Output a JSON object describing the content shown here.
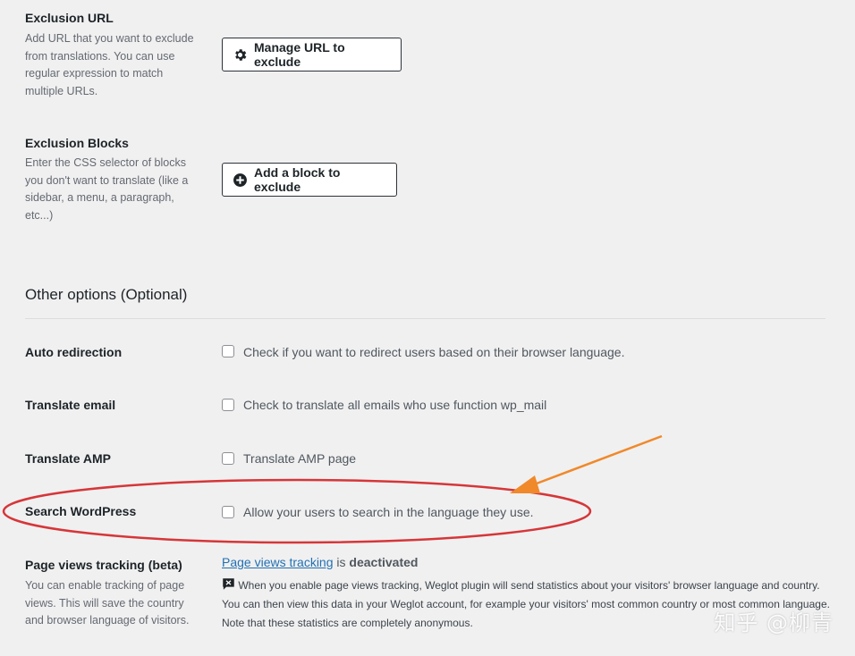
{
  "exclusion_url": {
    "label": "Exclusion URL",
    "description": [
      "Add URL that you want to exclude",
      "from translations. You can use",
      "regular expression to match",
      "multiple URLs."
    ],
    "button_label": "Manage URL to exclude",
    "button_icon": "gear-icon"
  },
  "exclusion_blocks": {
    "label": "Exclusion Blocks",
    "description": [
      "Enter the CSS selector of blocks",
      "you don't want to translate (like a",
      "sidebar, a menu, a paragraph,",
      "etc...)"
    ],
    "button_label": "Add a block to exclude",
    "button_icon": "plus-circle-icon"
  },
  "other_options": {
    "heading": "Other options (Optional)",
    "rows": [
      {
        "label": "Auto redirection",
        "checkbox_text": "Check if you want to redirect users based on their browser language.",
        "checked": false
      },
      {
        "label": "Translate email",
        "checkbox_text": "Check to translate all emails who use function wp_mail",
        "checked": false
      },
      {
        "label": "Translate AMP",
        "checkbox_text": "Translate AMP page",
        "checked": false
      },
      {
        "label": "Search WordPress",
        "checkbox_text": "Allow your users to search in the language they use.",
        "checked": false
      }
    ]
  },
  "page_views": {
    "label": "Page views tracking (beta)",
    "description": [
      "You can enable tracking of page",
      "views. This will save the country",
      "and browser language of visitors."
    ],
    "link_text": "Page views tracking",
    "is_text": "is",
    "status": "deactivated",
    "note": [
      "When you enable page views tracking, Weglot plugin will send statistics about your visitors' browser language and country.",
      "You can then view this data in your Weglot account, for example your visitors' most common country or most common language.",
      "Note that these statistics are completely anonymous."
    ],
    "note_icon": "message-icon"
  },
  "annotation": {
    "ellipse_color": "#d63638",
    "arrow_color": "#f0892a"
  },
  "watermark": "知乎 @柳青"
}
